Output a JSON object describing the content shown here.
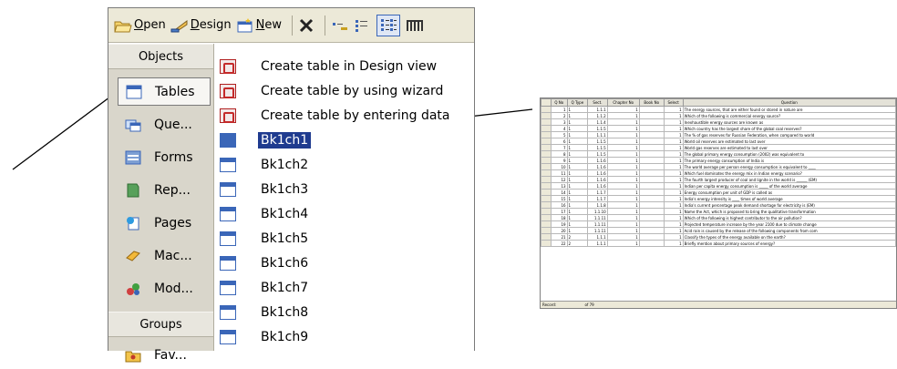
{
  "toolbar": {
    "open": {
      "u": "O",
      "rest": "pen"
    },
    "design": {
      "u": "D",
      "rest": "esign"
    },
    "new": {
      "u": "N",
      "rest": "ew"
    }
  },
  "sidebar": {
    "objects_header": "Objects",
    "items": [
      {
        "label": "Tables",
        "icon": "table-icon",
        "selected": true
      },
      {
        "label": "Que...",
        "icon": "query-icon"
      },
      {
        "label": "Forms",
        "icon": "form-icon"
      },
      {
        "label": "Rep...",
        "icon": "report-icon"
      },
      {
        "label": "Pages",
        "icon": "page-icon"
      },
      {
        "label": "Mac...",
        "icon": "macro-icon"
      },
      {
        "label": "Mod...",
        "icon": "module-icon"
      }
    ],
    "groups_header": "Groups",
    "groups": [
      {
        "label": "Fav...",
        "icon": "favorites-folder-icon"
      }
    ]
  },
  "list": {
    "items": [
      {
        "label": "Create table in Design view",
        "icon": "design-view-icon"
      },
      {
        "label": "Create table by using wizard",
        "icon": "wizard-icon"
      },
      {
        "label": "Create table by entering data",
        "icon": "datasheet-icon"
      },
      {
        "label": "Bk1ch1",
        "icon": "table-icon",
        "selected": true
      },
      {
        "label": "Bk1ch2",
        "icon": "table-icon"
      },
      {
        "label": "Bk1ch3",
        "icon": "table-icon"
      },
      {
        "label": "Bk1ch4",
        "icon": "table-icon"
      },
      {
        "label": "Bk1ch5",
        "icon": "table-icon"
      },
      {
        "label": "Bk1ch6",
        "icon": "table-icon"
      },
      {
        "label": "Bk1ch7",
        "icon": "table-icon"
      },
      {
        "label": "Bk1ch8",
        "icon": "table-icon"
      },
      {
        "label": "Bk1ch9",
        "icon": "table-icon"
      }
    ]
  },
  "datasheet": {
    "columns": [
      "Q No",
      "Q Type",
      "Sect.",
      "Chapter No",
      "Book No",
      "Select",
      "Question"
    ],
    "rows": [
      [
        "1",
        "1",
        "1.1.1",
        "1",
        "",
        "1",
        "The energy sources, that are either found or stored in nature are"
      ],
      [
        "2",
        "1",
        "1.1.2",
        "1",
        "",
        "1",
        "Which of the following is commercial energy source?"
      ],
      [
        "3",
        "1",
        "1.1.4",
        "1",
        "",
        "1",
        "Inexhaustible energy sources are known as"
      ],
      [
        "4",
        "1",
        "1.1.5",
        "1",
        "",
        "1",
        "Which country has the largest share of the global coal reserves?"
      ],
      [
        "5",
        "1",
        "1.1.1",
        "1",
        "",
        "1",
        "The % of gas reserves for Russian Federation, when compared to world"
      ],
      [
        "6",
        "1",
        "1.1.5",
        "1",
        "",
        "1",
        "World oil reserves are estimated to last over"
      ],
      [
        "7",
        "1",
        "1.1.5",
        "1",
        "",
        "1",
        "World gas reserves are estimated to last over"
      ],
      [
        "8",
        "1",
        "1.1.5",
        "1",
        "",
        "1",
        "The global primary energy consumption (2002) was equivalent to"
      ],
      [
        "9",
        "1",
        "1.1.6",
        "1",
        "",
        "1",
        "The primary energy consumption of India is"
      ],
      [
        "10",
        "1",
        "1.1.6",
        "1",
        "",
        "1",
        "The world average per person energy consumption is equivalent to ____"
      ],
      [
        "11",
        "1",
        "1.1.6",
        "1",
        "",
        "1",
        "Which fuel dominates the energy mix in Indian energy scenario?"
      ],
      [
        "12",
        "1",
        "1.1.6",
        "1",
        "",
        "1",
        "The fourth largest producer of coal and lignite in the world is ______ (EM)"
      ],
      [
        "13",
        "1",
        "1.1.6",
        "1",
        "",
        "1",
        "Indian per capita energy consumption is _____ of the world average"
      ],
      [
        "14",
        "1",
        "1.1.7",
        "1",
        "",
        "1",
        "Energy consumption per unit of GDP is called as"
      ],
      [
        "15",
        "1",
        "1.1.7",
        "1",
        "",
        "1",
        "India's energy intensity is ____ times of world average"
      ],
      [
        "16",
        "1",
        "1.1.8",
        "1",
        "",
        "1",
        "India's current percentage peak demand shortage for electricity is (EM)"
      ],
      [
        "17",
        "1",
        "1.1.10",
        "1",
        "",
        "1",
        "Name the Act, which is proposed to bring the qualitative transformation"
      ],
      [
        "18",
        "1",
        "1.1.11",
        "1",
        "",
        "1",
        "Which of the following is highest contributor to the air pollution?"
      ],
      [
        "19",
        "1",
        "1.1.11",
        "1",
        "",
        "1",
        "Projected temperature increase by the year 2100 due to climate change"
      ],
      [
        "20",
        "1",
        "1.1.11",
        "1",
        "",
        "1",
        "Acid rain is caused by the release of the following components from com"
      ],
      [
        "21",
        "2",
        "1.1.1",
        "1",
        "",
        "1",
        "Classify the types of the energy available on the earth?"
      ],
      [
        "22",
        "2",
        "1.1.1",
        "1",
        "",
        "1",
        "Briefly mention about primary sources of energy?"
      ]
    ],
    "nav_label": "Record:",
    "nav_of": "of 79"
  }
}
